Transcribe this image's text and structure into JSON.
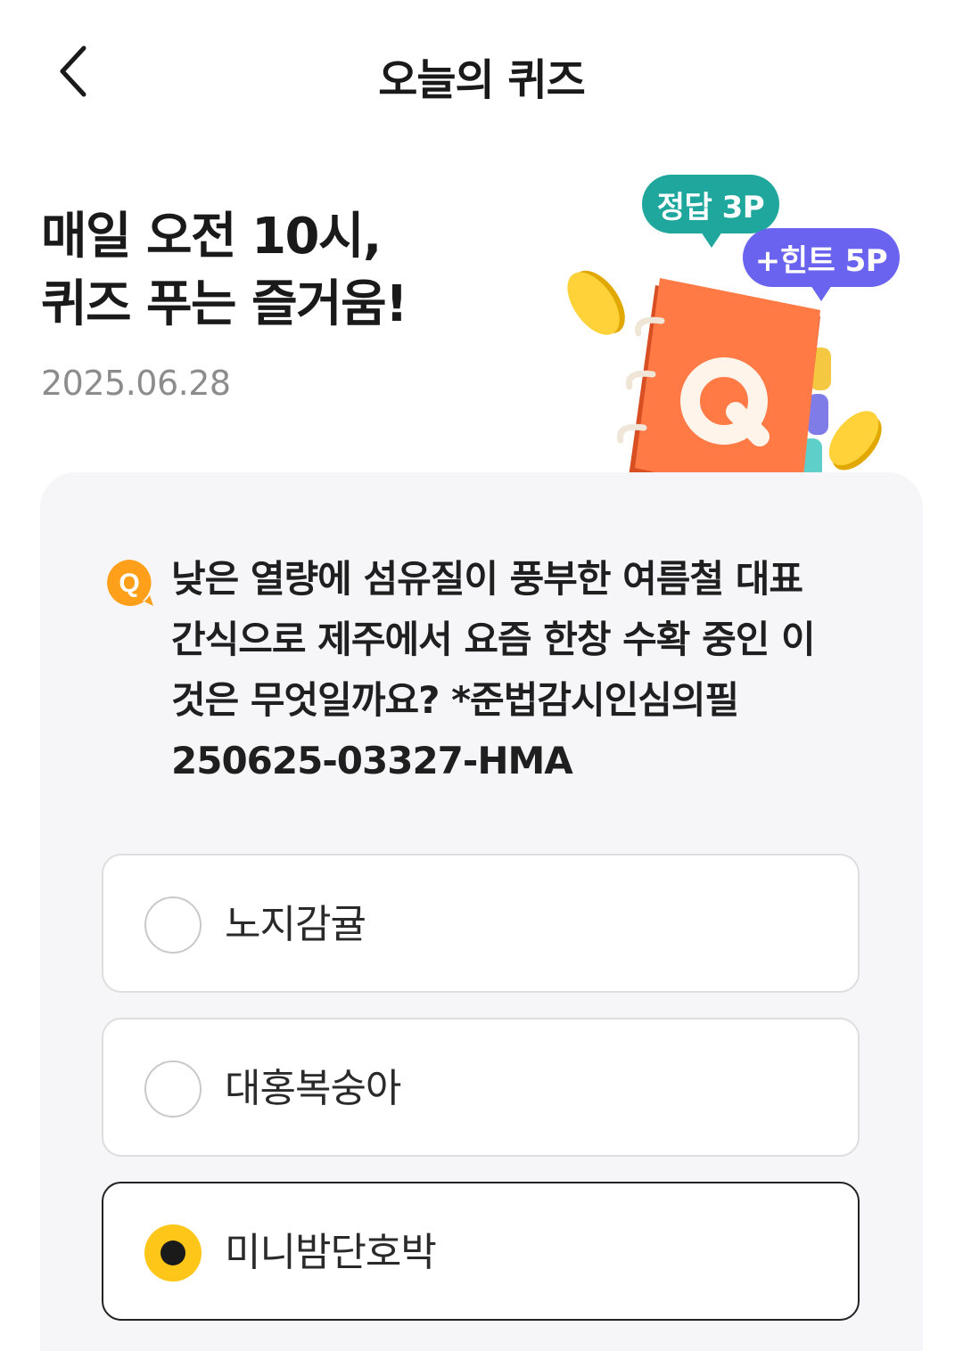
{
  "header": {
    "title": "오늘의 퀴즈",
    "back_icon": "chevron-left-icon"
  },
  "hero": {
    "title_line1": "매일 오전 10시,",
    "title_line2": "퀴즈 푸는 즐거움!",
    "date": "2025.06.28"
  },
  "illustration": {
    "answer_badge": "정답 3P",
    "hint_badge": "+힌트 5P",
    "book_letter": "Q",
    "colors": {
      "answer": "#1fa79e",
      "hint": "#6a63f0",
      "book": "#f26a3c",
      "coin": "#f7c51b"
    }
  },
  "quiz": {
    "badge": "Q",
    "question_lines": [
      "낮은 열량에 섬유질이 풍부한 여름철 대표",
      "간식으로 제주에서 요즘 한창 수확 중인 이",
      "것은 무엇일까요? *준법감시인심의필",
      "250625-03327-HMA"
    ],
    "options": [
      {
        "label": "노지감귤",
        "selected": false
      },
      {
        "label": "대홍복숭아",
        "selected": false
      },
      {
        "label": "미니밤단호박",
        "selected": true
      }
    ],
    "accent_color": "#ffc61a"
  }
}
